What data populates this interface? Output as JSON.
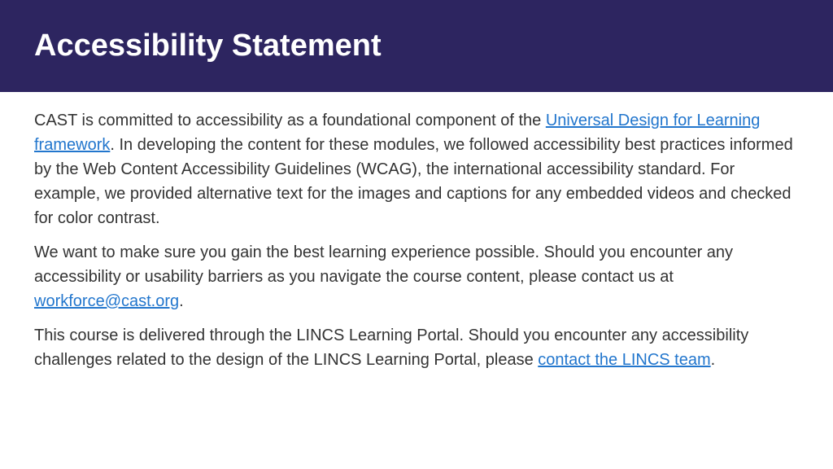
{
  "header": {
    "title": "Accessibility Statement"
  },
  "content": {
    "p1_part1": "CAST is committed to accessibility as a foundational component of the ",
    "p1_link1": "Universal Design for Learning framework",
    "p1_part2": ". In developing the content for these modules, we followed accessibility best practices informed by the Web Content Accessibility Guidelines (WCAG), the international accessibility standard. For example, we provided alternative text for the images and captions for any embedded videos and checked for color contrast.",
    "p2_part1": "We want to make sure you gain the best learning experience possible. Should you encounter any accessibility or usability barriers as you navigate the course content, please contact us at ",
    "p2_link1": "workforce@cast.org",
    "p2_part2": ".",
    "p3_part1": "This course is delivered through the LINCS Learning Portal. Should you encounter any accessibility challenges related to the design of the LINCS Learning Portal, please ",
    "p3_link1": "contact the LINCS team",
    "p3_part2": "."
  }
}
